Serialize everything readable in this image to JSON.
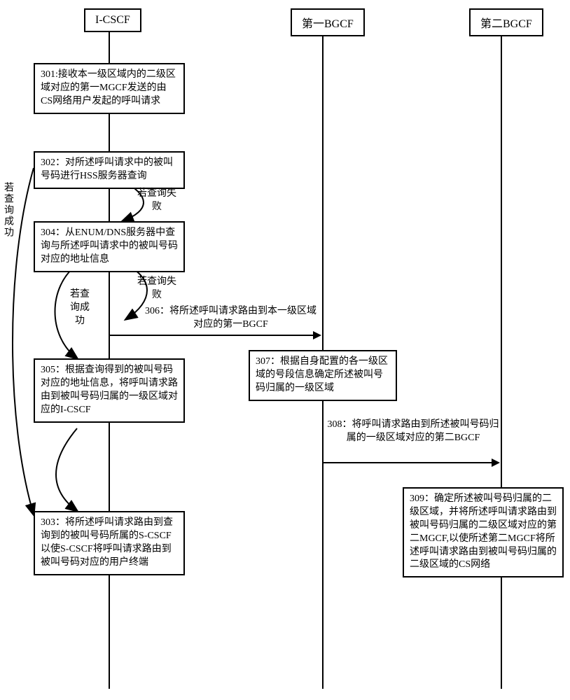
{
  "lifelines": {
    "l1": "I-CSCF",
    "l2": "第一BGCF",
    "l3": "第二BGCF"
  },
  "steps": {
    "s301": "301:接收本一级区域内的二级区域对应的第一MGCF发送的由CS网络用户发起的呼叫请求",
    "s302": "302：对所述呼叫请求中的被叫号码进行HSS服务器查询",
    "s303": "303：将所述呼叫请求路由到查询到的被叫号码所属的S-CSCF以使S-CSCF将呼叫请求路由到被叫号码对应的用户终端",
    "s304": "304：从ENUM/DNS服务器中查询与所述呼叫请求中的被叫号码对应的地址信息",
    "s305": "305：根据查询得到的被叫号码对应的地址信息，将呼叫请求路由到被叫号码归属的一级区域对应的I-CSCF",
    "s307": "307：根据自身配置的各一级区域的号段信息确定所述被叫号码归属的一级区域",
    "s309": "309：确定所述被叫号码归属的二级区域，并将所述呼叫请求路由到被叫号码归属的二级区域对应的第二MGCF,以使所述第二MGCF将所述呼叫请求路由到被叫号码归属的二级区域的CS网络"
  },
  "messages": {
    "m306": "306：将所述呼叫请求路由到本一级区域对应的第一BGCF",
    "m308": "308：将呼叫请求路由到所述被叫号码归属的一级区域对应的第二BGCF"
  },
  "edges": {
    "success_vert": "若查询成功",
    "fail1": "若查询失败",
    "fail2": "若查询失败",
    "success2": "若查询成功"
  }
}
